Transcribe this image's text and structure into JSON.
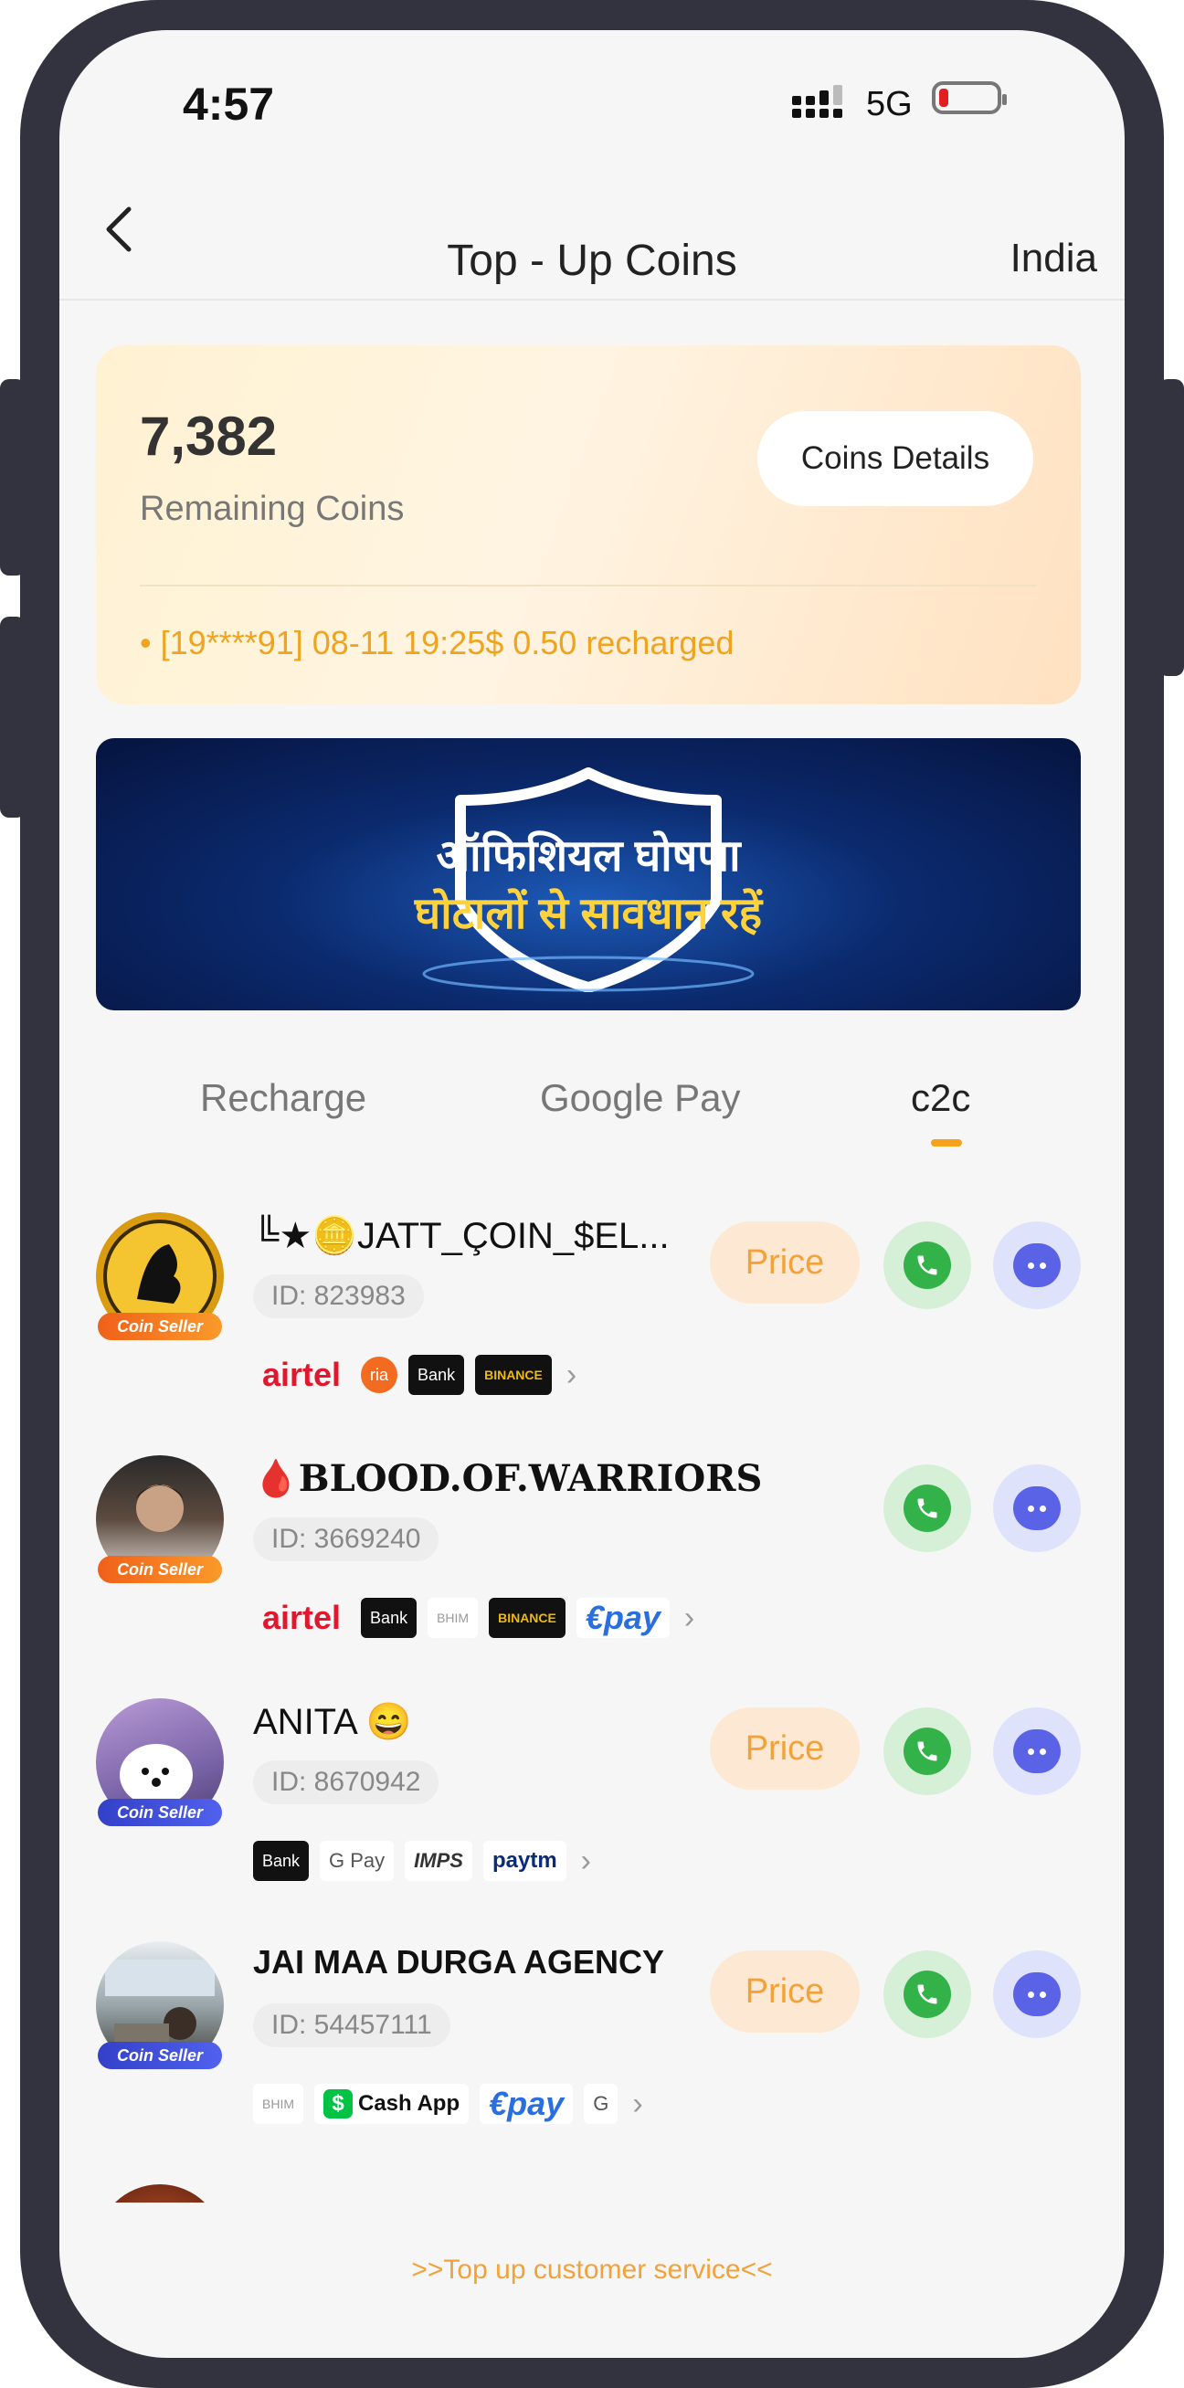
{
  "status_bar": {
    "time": "4:57",
    "network": "5G"
  },
  "nav": {
    "back_icon": "‹",
    "title": "Top - Up Coins",
    "region": "India"
  },
  "coins": {
    "value": "7,382",
    "label": "Remaining Coins",
    "details_button": "Coins Details",
    "notice": "• [19****91] 08-11 19:25$ 0.50 recharged"
  },
  "banner": {
    "line1": "ऑफिशियल घोषणा",
    "line2": "घोटालों से सावधान रहें"
  },
  "tabs": [
    {
      "label": "Recharge",
      "active": false
    },
    {
      "label": "Google Pay",
      "active": false
    },
    {
      "label": "c2c",
      "active": true
    }
  ],
  "sellers": [
    {
      "name": "╚★🪙JATT_ÇOIN_$EL...",
      "id": "ID: 823983",
      "badge": "Coin Seller",
      "price_label": "Price",
      "payments": [
        "airtel",
        "ria",
        "Bank",
        "BINANCE"
      ]
    },
    {
      "name": "🩸BLOOD.OF.WARRIORS",
      "id": "ID: 3669240",
      "badge": "Coin Seller",
      "price_label": "",
      "payments": [
        "airtel",
        "Bank",
        "BHIM",
        "BINANCE",
        "€pay"
      ]
    },
    {
      "name": "ANITA 😄",
      "id": "ID: 8670942",
      "badge": "Coin Seller",
      "price_label": "Price",
      "payments": [
        "Bank",
        "G Pay",
        "IMPS",
        "paytm"
      ]
    },
    {
      "name": "JAI MAA DURGA AGENCY",
      "id": "ID: 54457111",
      "badge": "Coin Seller",
      "price_label": "Price",
      "payments": [
        "BHIM",
        "Cash App",
        "€pay",
        "G"
      ]
    }
  ],
  "footer": {
    "link": ">>Top up customer service<<"
  },
  "colors": {
    "accent": "#f7a21c",
    "call": "#33b24a",
    "chat": "#5a63e6",
    "airtel": "#e0182d"
  }
}
